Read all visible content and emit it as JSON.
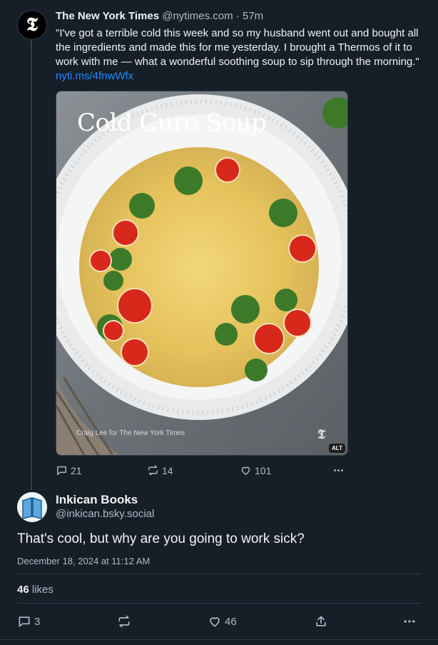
{
  "parent": {
    "author_name": "The New York Times",
    "author_handle": "@nytimes.com",
    "separator": "·",
    "time": "57m",
    "avatar_glyph": "𝕿",
    "text": "\"I've got a terrible cold this week and so my husband went out and bought all the ingredients and made this for me yesterday. I brought a Thermos of it to work with me — what a wonderful soothing soup to sip through the morning.\"",
    "link": "nyti.ms/4fnwWfx",
    "image": {
      "title": "Cold Cure Soup",
      "credit": "Craig Lee for The New York Times",
      "logo": "𝕿",
      "alt_badge": "ALT"
    },
    "actions": {
      "replies": "21",
      "reposts": "14",
      "likes": "101"
    }
  },
  "reply": {
    "author_name": "Inkican Books",
    "author_handle": "@inkican.bsky.social",
    "text": "That's cool, but why are you going to work sick?",
    "date": "December 18, 2024 at 11:12 AM",
    "likes_count": "46",
    "likes_label": "likes",
    "actions": {
      "replies": "3",
      "likes": "46"
    }
  },
  "colors": {
    "background": "#161e27",
    "text": "#f1f3f5",
    "muted": "#aebbc9",
    "link": "#208bfe",
    "border": "#2e4052"
  }
}
